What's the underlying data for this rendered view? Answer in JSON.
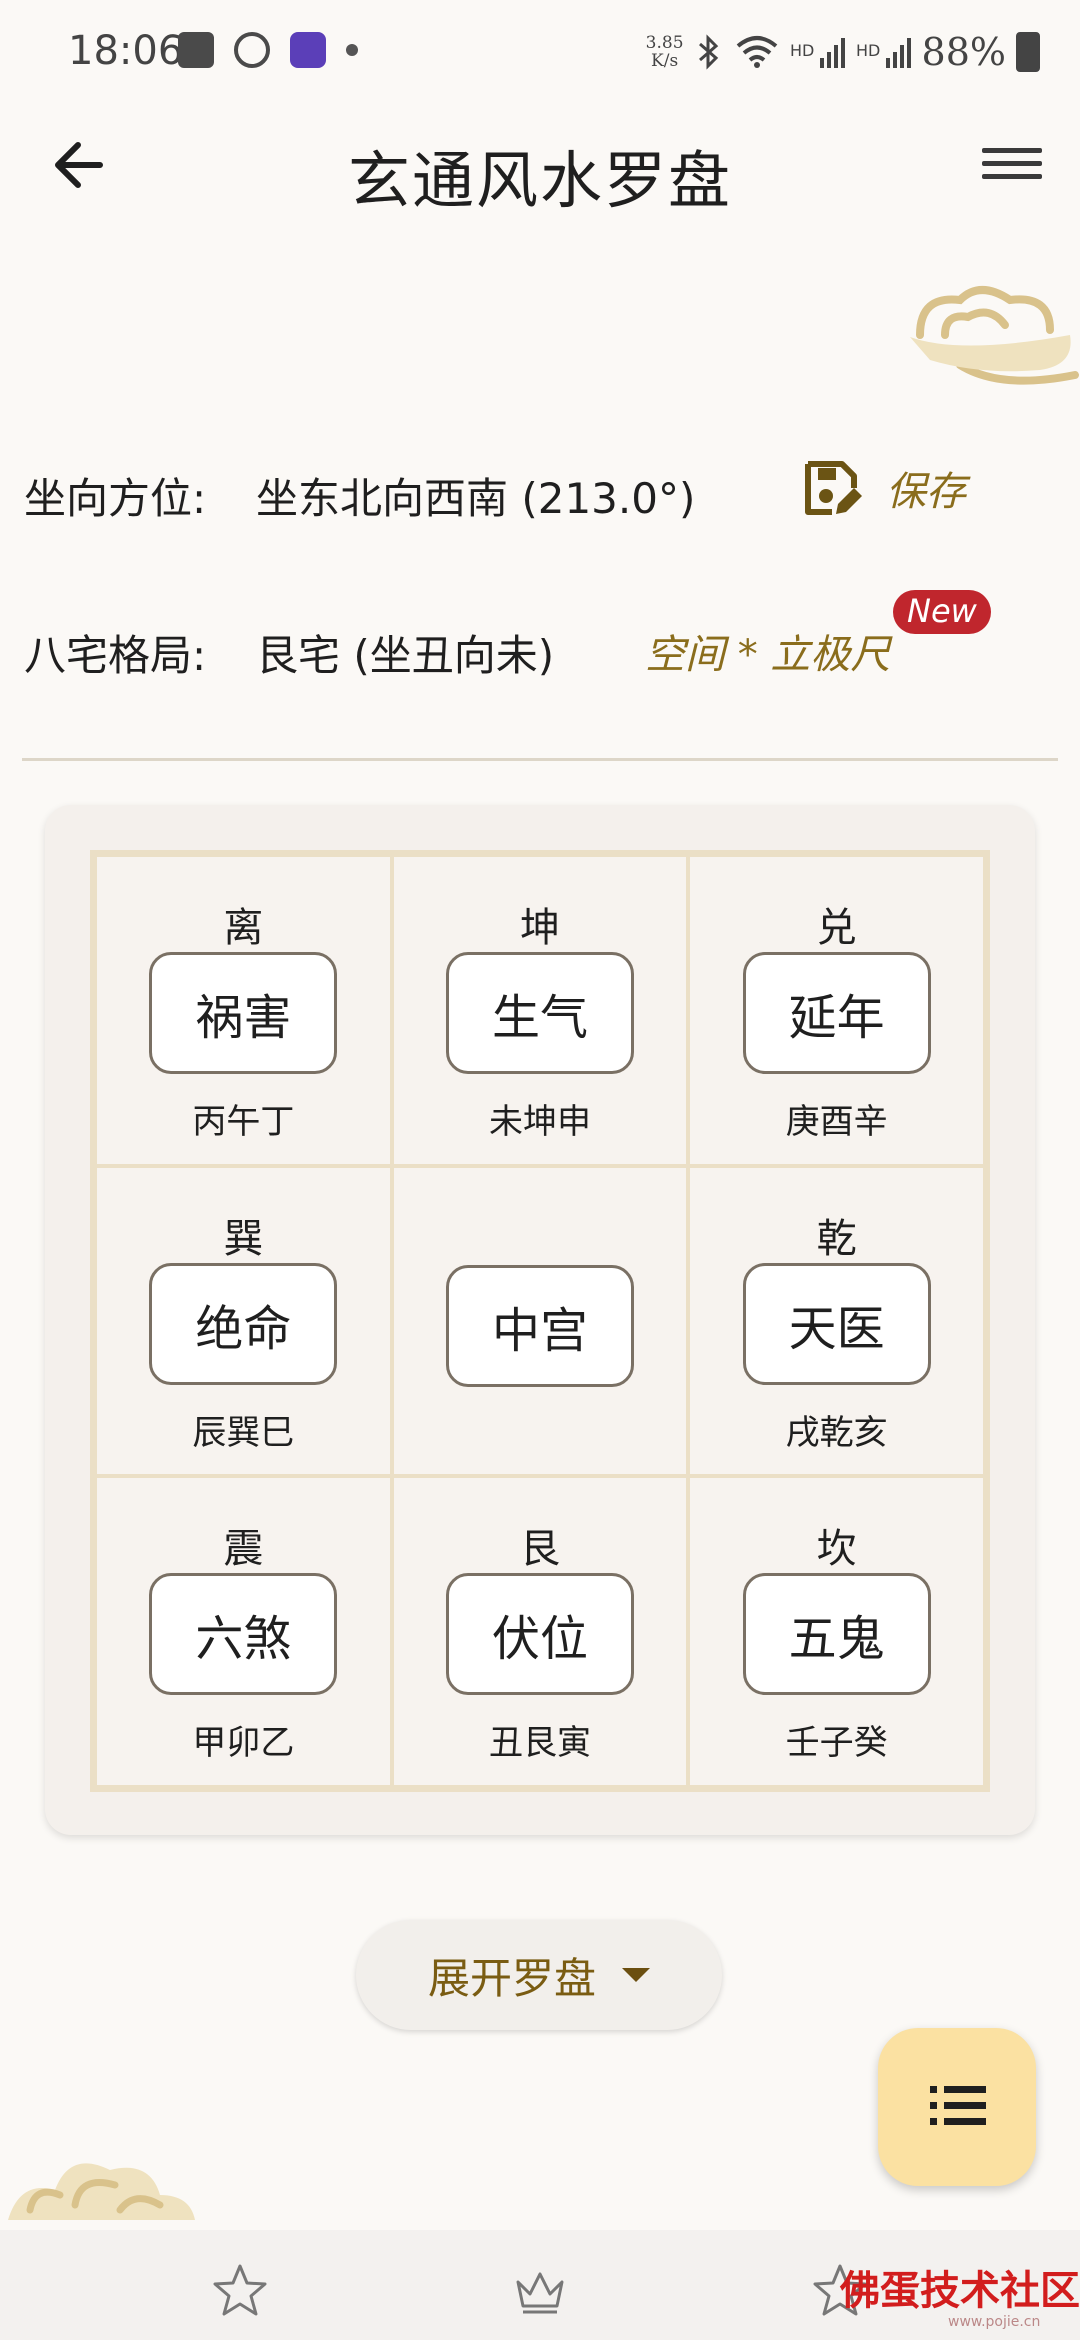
{
  "status_bar": {
    "time": "18:06",
    "speed_value": "3.85",
    "speed_unit": "K/s",
    "battery": "88%",
    "icons": [
      "gallery-icon",
      "compass-icon",
      "app-icon",
      "dot-icon",
      "bluetooth-icon",
      "wifi-icon",
      "signal-icon",
      "battery-icon"
    ]
  },
  "header": {
    "title": "玄通风水罗盘"
  },
  "info": {
    "orientation_label": "坐向方位:",
    "orientation_value": "坐东北向西南 (213.0°)",
    "save_label": "保存",
    "house_label": "八宅格局:",
    "house_value": "艮宅 (坐丑向未)",
    "ruler_label": "空间 * 立极尺",
    "new_badge": "New"
  },
  "grid": {
    "cells": [
      {
        "name": "离",
        "value": "祸害",
        "dirs": "丙午丁"
      },
      {
        "name": "坤",
        "value": "生气",
        "dirs": "未坤申"
      },
      {
        "name": "兑",
        "value": "延年",
        "dirs": "庚酉辛"
      },
      {
        "name": "巽",
        "value": "绝命",
        "dirs": "辰巽巳"
      },
      {
        "name": "",
        "value": "中宫",
        "dirs": ""
      },
      {
        "name": "乾",
        "value": "天医",
        "dirs": "戌乾亥"
      },
      {
        "name": "震",
        "value": "六煞",
        "dirs": "甲卯乙"
      },
      {
        "name": "艮",
        "value": "伏位",
        "dirs": "丑艮寅"
      },
      {
        "name": "坎",
        "value": "五鬼",
        "dirs": "壬子癸"
      }
    ]
  },
  "expand_button": {
    "label": "展开罗盘"
  },
  "bottom_nav": {
    "items": [
      "star-icon",
      "crown-icon",
      "star-icon"
    ]
  },
  "watermark": {
    "text": "佛蛋技术社区",
    "url": "www.pojie.cn"
  },
  "colors": {
    "accent": "#8a6d1c",
    "badge": "#c0262d",
    "fab": "#fbe1a2",
    "grid_border": "#ebdfc6"
  }
}
